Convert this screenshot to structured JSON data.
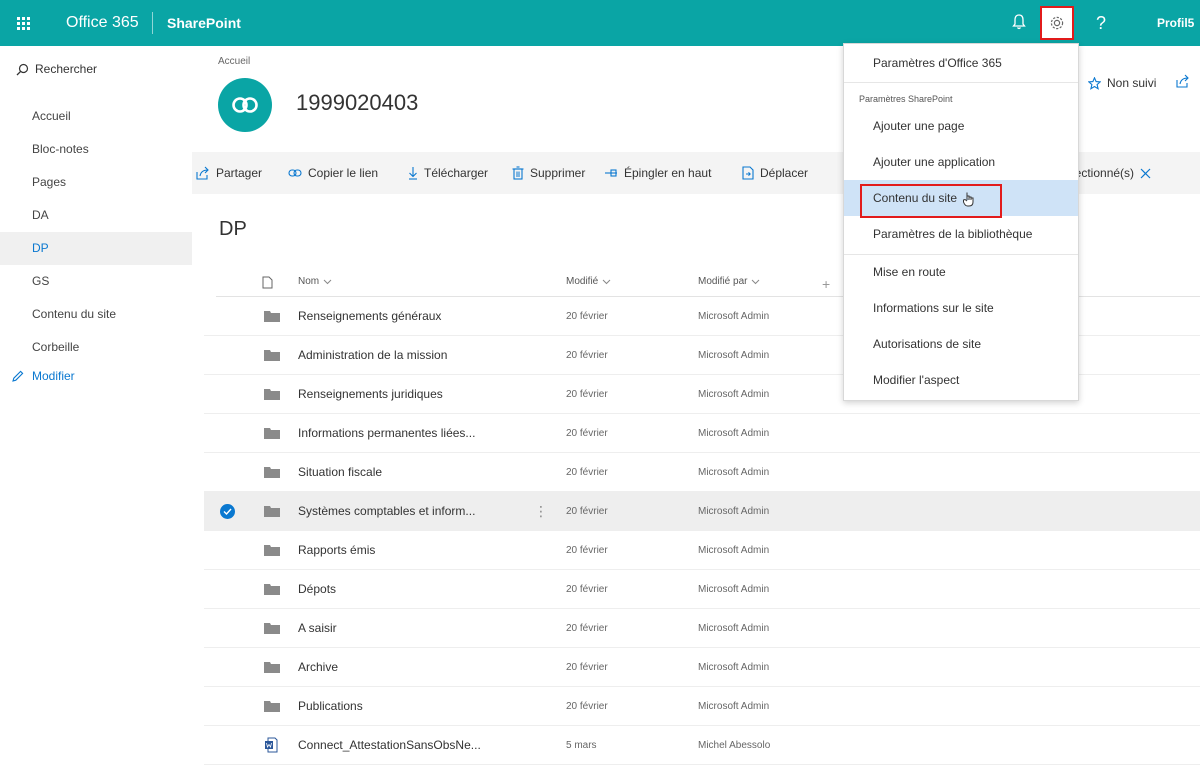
{
  "suite_bar": {
    "brand": "Office 365",
    "app": "SharePoint",
    "help": "?",
    "profile": "Profil5",
    "icons": [
      "app-launcher-icon",
      "bell-icon",
      "gear-icon"
    ]
  },
  "left_nav": {
    "search_label": "Rechercher",
    "items": [
      {
        "label": "Accueil",
        "active": false
      },
      {
        "label": "Bloc-notes",
        "active": false
      },
      {
        "label": "Pages",
        "active": false
      },
      {
        "label": "DA",
        "active": false
      },
      {
        "label": "DP",
        "active": true
      },
      {
        "label": "GS",
        "active": false
      },
      {
        "label": "Contenu du site",
        "active": false
      },
      {
        "label": "Corbeille",
        "active": false
      }
    ],
    "edit_label": "Modifier"
  },
  "site": {
    "breadcrumb": "Accueil",
    "title": "1999020403",
    "follow_label": "Non suivi"
  },
  "command_bar": {
    "share": "Partager",
    "copy_link": "Copier le lien",
    "download": "Télécharger",
    "delete": "Supprimer",
    "pin": "Épingler en haut",
    "move": "Déplacer",
    "selected_count": "lectionné(s)"
  },
  "library": {
    "title": "DP",
    "columns": {
      "name": "Nom",
      "modified": "Modifié",
      "modified_by": "Modifié par"
    },
    "rows": [
      {
        "name": "Renseignements généraux",
        "modified": "20 février",
        "modified_by": "Microsoft Admin",
        "type": "folder",
        "selected": false
      },
      {
        "name": "Administration de la mission",
        "modified": "20 février",
        "modified_by": "Microsoft Admin",
        "type": "folder",
        "selected": false
      },
      {
        "name": "Renseignements juridiques",
        "modified": "20 février",
        "modified_by": "Microsoft Admin",
        "type": "folder",
        "selected": false
      },
      {
        "name": "Informations permanentes liées...",
        "modified": "20 février",
        "modified_by": "Microsoft Admin",
        "type": "folder",
        "selected": false
      },
      {
        "name": "Situation fiscale",
        "modified": "20 février",
        "modified_by": "Microsoft Admin",
        "type": "folder",
        "selected": false
      },
      {
        "name": "Systèmes comptables et inform...",
        "modified": "20 février",
        "modified_by": "Microsoft Admin",
        "type": "folder",
        "selected": true
      },
      {
        "name": "Rapports émis",
        "modified": "20 février",
        "modified_by": "Microsoft Admin",
        "type": "folder",
        "selected": false
      },
      {
        "name": "Dépots",
        "modified": "20 février",
        "modified_by": "Microsoft Admin",
        "type": "folder",
        "selected": false
      },
      {
        "name": "A saisir",
        "modified": "20 février",
        "modified_by": "Microsoft Admin",
        "type": "folder",
        "selected": false
      },
      {
        "name": "Archive",
        "modified": "20 février",
        "modified_by": "Microsoft Admin",
        "type": "folder",
        "selected": false
      },
      {
        "name": "Publications",
        "modified": "20 février",
        "modified_by": "Microsoft Admin",
        "type": "folder",
        "selected": false
      },
      {
        "name": "Connect_AttestationSansObsNe...",
        "modified": "5 mars",
        "modified_by": "Michel Abessolo",
        "type": "word-file",
        "selected": false
      }
    ]
  },
  "settings_menu": {
    "office_settings": "Paramètres d'Office 365",
    "section_label": "Paramètres SharePoint",
    "items": [
      {
        "label": "Ajouter une page",
        "highlighted": false
      },
      {
        "label": "Ajouter une application",
        "highlighted": false
      },
      {
        "label": "Contenu du site",
        "highlighted": true
      },
      {
        "label": "Paramètres de la bibliothèque",
        "highlighted": false
      },
      {
        "label": "Mise en route",
        "highlighted": false
      },
      {
        "label": "Informations sur le site",
        "highlighted": false
      },
      {
        "label": "Autorisations de site",
        "highlighted": false
      },
      {
        "label": "Modifier l'aspect",
        "highlighted": false
      }
    ]
  },
  "colors": {
    "suite_bar": "#0aa5a5",
    "accent_blue": "#0a78d0",
    "highlight_box": "#e21b1b",
    "menu_highlight": "#cfe3f7"
  }
}
